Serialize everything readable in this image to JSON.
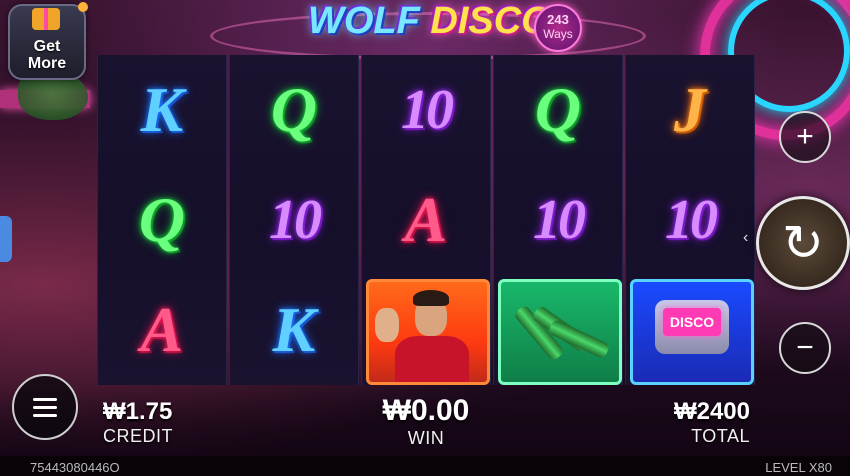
{
  "header": {
    "logo_word_1": "WOLF",
    "logo_word_2": "DISCO",
    "ways_count": "243",
    "ways_label": "Ways"
  },
  "promo": {
    "get_more_label_1": "Get",
    "get_more_label_2": "More"
  },
  "reels": [
    [
      {
        "type": "letter",
        "text": "K",
        "color": "blue"
      },
      {
        "type": "letter",
        "text": "Q",
        "color": "green"
      },
      {
        "type": "letter",
        "text": "A",
        "color": "red"
      }
    ],
    [
      {
        "type": "letter",
        "text": "Q",
        "color": "green"
      },
      {
        "type": "letter",
        "text": "10",
        "color": "purple"
      },
      {
        "type": "letter",
        "text": "K",
        "color": "blue"
      }
    ],
    [
      {
        "type": "letter",
        "text": "10",
        "color": "purple"
      },
      {
        "type": "letter",
        "text": "A",
        "color": "red"
      },
      {
        "type": "image",
        "symbol": "singer-portrait"
      }
    ],
    [
      {
        "type": "letter",
        "text": "Q",
        "color": "green"
      },
      {
        "type": "letter",
        "text": "10",
        "color": "purple"
      },
      {
        "type": "image",
        "symbol": "bottles"
      }
    ],
    [
      {
        "type": "letter",
        "text": "J",
        "color": "orange"
      },
      {
        "type": "letter",
        "text": "10",
        "color": "purple"
      },
      {
        "type": "image",
        "symbol": "disco-pager",
        "text": "DISCO"
      }
    ]
  ],
  "controls": {
    "plus_icon": "plus-icon",
    "minus_icon": "minus-icon",
    "spin_icon": "spin-refresh-icon",
    "menu_icon": "menu-icon"
  },
  "stats": {
    "credit_value": "₩1.75",
    "credit_label": "CREDIT",
    "win_value": "₩0.00",
    "win_label": "WIN",
    "total_value": "₩2400",
    "total_label": "TOTAL"
  },
  "footer": {
    "game_id": "75443080446O",
    "level_label": "LEVEL",
    "level_value": "X80"
  },
  "colors": {
    "blue": "#5fd0ff",
    "green": "#6bff7e",
    "purple": "#d88bff",
    "red": "#ff5a8a",
    "orange": "#ffb44a"
  }
}
